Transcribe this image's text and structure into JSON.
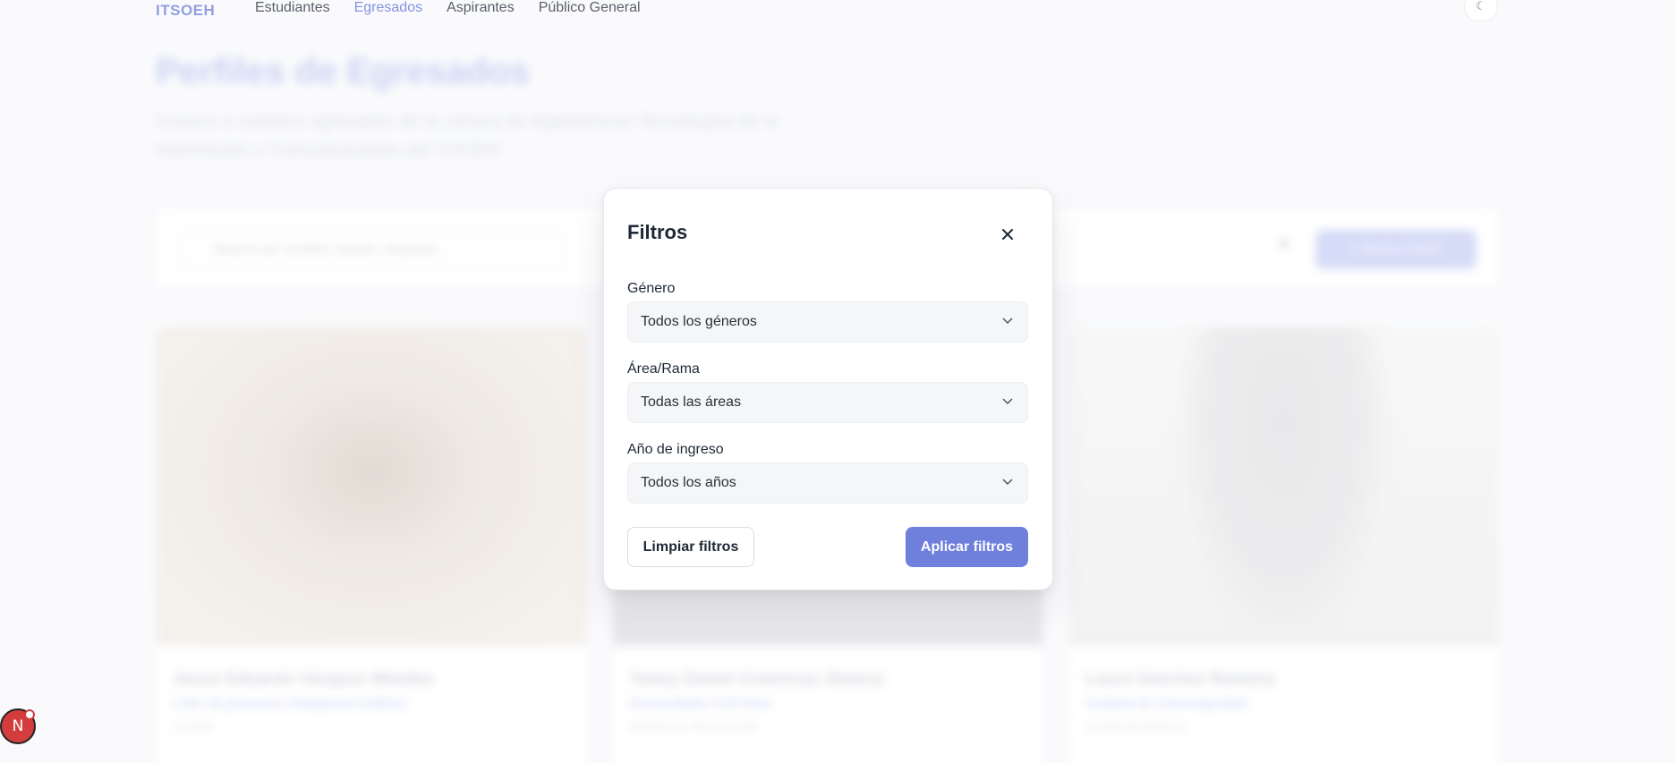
{
  "nav": {
    "brand": "ITSOEH",
    "links": [
      "Estudiantes",
      "Egresados",
      "Aspirantes",
      "Público General"
    ],
    "active_link": "Egresados",
    "theme_icon": "moon-icon"
  },
  "hero": {
    "title": "Perfiles de Egresados",
    "subtitle": "Conoce a nuestros egresados de la carrera de Ingeniería en Tecnologías de la Información y Comunicaciones del ITSOEH"
  },
  "toolbar": {
    "search_placeholder": "Buscar por nombre, puesto, empresa...",
    "new_profile_label": "+ Nuevo Perfil"
  },
  "cards": [
    {
      "name": "Jesús Eduardo Vázquez Méndez",
      "role": "Líder de proyectos Inteligencia Artificial",
      "location": "Ciudad"
    },
    {
      "name": "Yoany Daniel Contreras Álvarez",
      "role": "Desarrollador Full Stack",
      "location": "Monterrey, Nuevo León"
    },
    {
      "name": "Laura Sánchez Ramírez",
      "role": "Analista de Ciberseguridad",
      "location": "Ciudad de México"
    }
  ],
  "modal": {
    "title": "Filtros",
    "close_icon": "close-icon",
    "fields": [
      {
        "label": "Género",
        "value": "Todos los géneros"
      },
      {
        "label": "Área/Rama",
        "value": "Todas las áreas"
      },
      {
        "label": "Año de ingreso",
        "value": "Todos los años"
      }
    ],
    "clear_label": "Limpiar filtros",
    "apply_label": "Aplicar filtros"
  },
  "dev_badge": {
    "label": "N"
  },
  "colors": {
    "accent": "#6f7fdc",
    "nav_active": "#5a6fd6",
    "badge": "#d43d3d"
  }
}
